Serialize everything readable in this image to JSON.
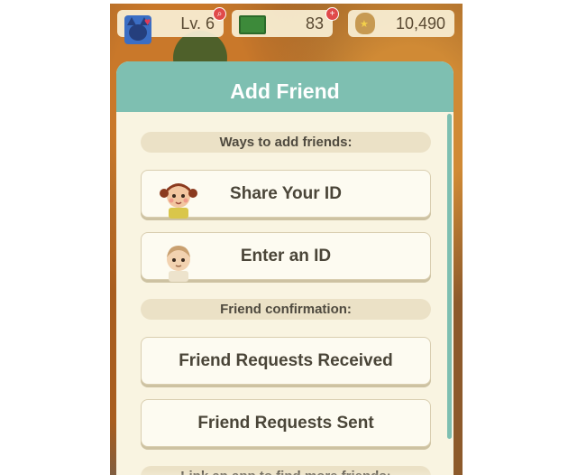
{
  "status_bar": {
    "level": "Lv. 6",
    "tickets": "83",
    "bells": "10,490"
  },
  "dialog": {
    "title": "Add Friend",
    "section_add": "Ways to add friends:",
    "share_id": "Share Your ID",
    "enter_id": "Enter an ID",
    "section_confirm": "Friend confirmation:",
    "requests_received": "Friend Requests Received",
    "requests_sent": "Friend Requests Sent",
    "section_link": "Link an app to find more friends:"
  },
  "colors": {
    "header": "#7ebfb1",
    "panel": "#f9f4e1",
    "button": "#fdfbf1",
    "label_bg": "#ebe1c6",
    "text": "#4a4538"
  }
}
